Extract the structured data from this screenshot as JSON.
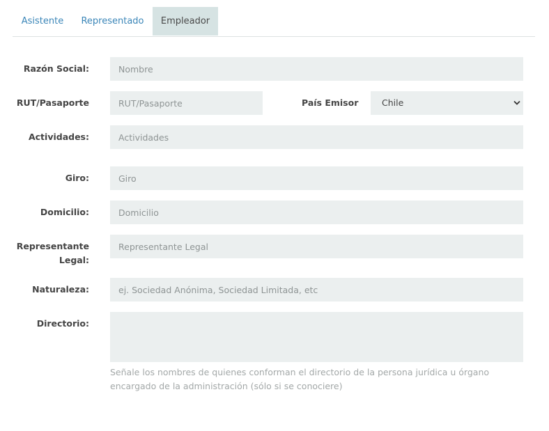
{
  "tabs": [
    {
      "label": "Asistente"
    },
    {
      "label": "Representado"
    },
    {
      "label": "Empleador"
    }
  ],
  "form": {
    "razon_social": {
      "label": "Razón Social:",
      "placeholder": "Nombre",
      "value": ""
    },
    "rut": {
      "label": "RUT/Pasaporte",
      "placeholder": "RUT/Pasaporte",
      "value": ""
    },
    "pais_emisor": {
      "label": "País Emisor",
      "selected": "Chile"
    },
    "actividades": {
      "label": "Actividades:",
      "placeholder": "Actividades",
      "value": ""
    },
    "giro": {
      "label": "Giro:",
      "placeholder": "Giro",
      "value": ""
    },
    "domicilio": {
      "label": "Domicilio:",
      "placeholder": "Domicilio",
      "value": ""
    },
    "representante": {
      "label": "Representante Legal:",
      "placeholder": "Representante Legal",
      "value": ""
    },
    "naturaleza": {
      "label": "Naturaleza:",
      "placeholder": "ej. Sociedad Anónima, Sociedad Limitada, etc",
      "value": ""
    },
    "directorio": {
      "label": "Directorio:",
      "placeholder": "",
      "value": ""
    },
    "directorio_help": "Señale los nombres de quienes conforman el directorio de la persona jurídica u órgano encargado de la administración (sólo si se conociere)"
  },
  "icons": {
    "select_arrow": "chevron-down-icon"
  }
}
